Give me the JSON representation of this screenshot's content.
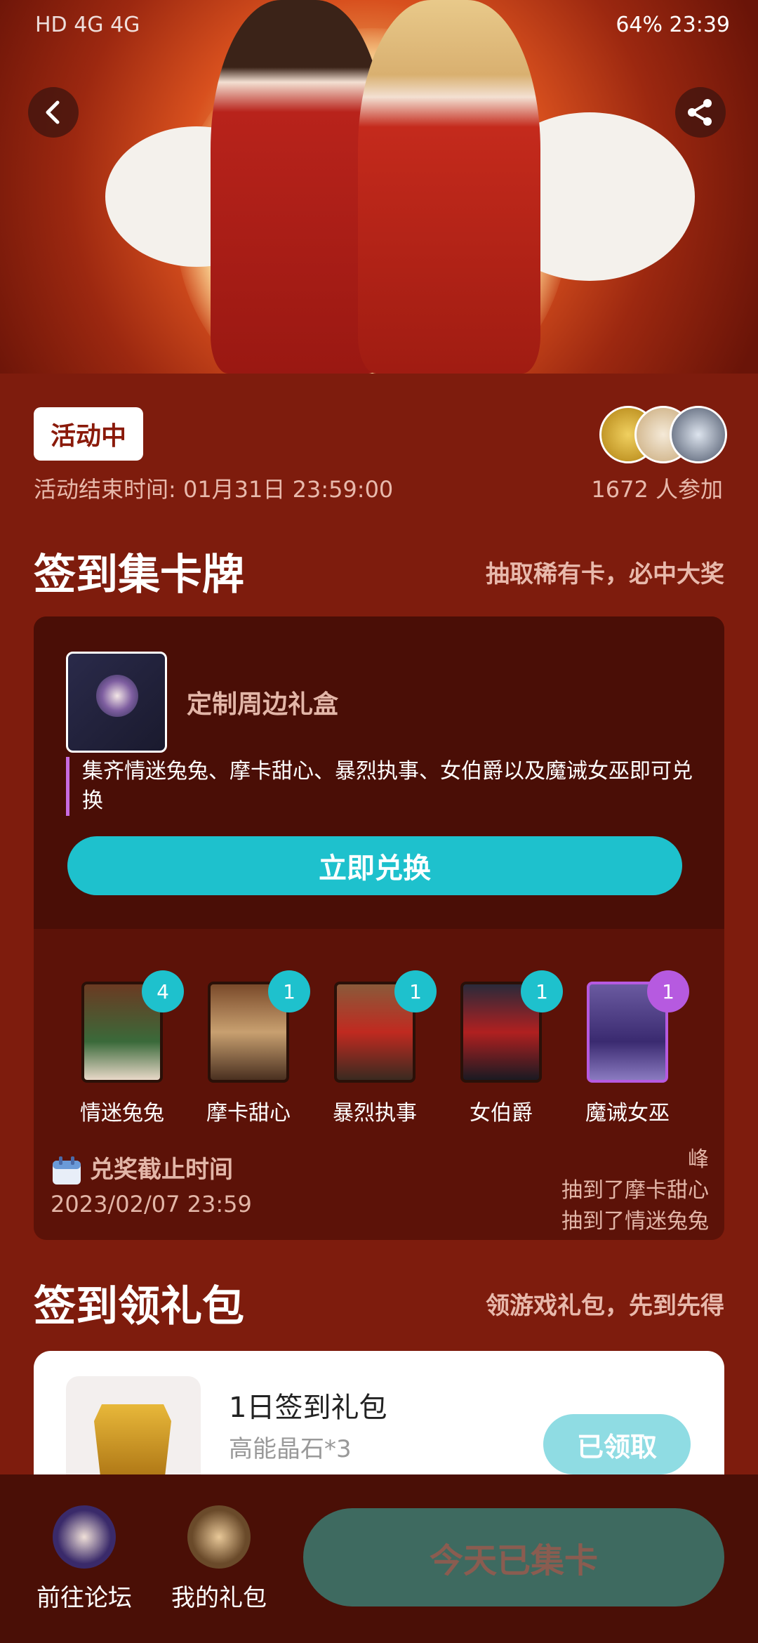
{
  "status_bar": {
    "left": "HD 4G 4G",
    "right": "64% 23:39"
  },
  "hero": {
    "back_label": "back",
    "share_label": "share"
  },
  "event": {
    "status_badge": "活动中",
    "end_time": "活动结束时间: 01月31日 23:59:00",
    "participants": "1672 人参加"
  },
  "card_section": {
    "title": "签到集卡牌",
    "subtitle": "抽取稀有卡，必中大奖",
    "reward_name": "定制周边礼盒",
    "reward_desc": "集齐情迷兔兔、摩卡甜心、暴烈执事、女伯爵以及魔诫女巫即可兑换",
    "redeem_button": "立即兑换",
    "cards": [
      {
        "name": "情迷兔兔",
        "count": "4",
        "color": "#1ec1cd"
      },
      {
        "name": "摩卡甜心",
        "count": "1",
        "color": "#1ec1cd"
      },
      {
        "name": "暴烈执事",
        "count": "1",
        "color": "#1ec1cd"
      },
      {
        "name": "女伯爵",
        "count": "1",
        "color": "#1ec1cd"
      },
      {
        "name": "魔诫女巫",
        "count": "1",
        "color": "#b65ae0"
      }
    ],
    "deadline_label": "兑奖截止时间",
    "deadline_value": "2023/02/07 23:59",
    "ticker": [
      "峰",
      "抽到了摩卡甜心",
      "抽到了情迷兔兔"
    ]
  },
  "gift_section": {
    "title": "签到领礼包",
    "subtitle": "领游戏礼包，先到先得",
    "pack_name": "1日签到礼包",
    "pack_desc": "高能晶石*3",
    "claimed_button": "已领取"
  },
  "bottom_bar": {
    "forum_label": "前往论坛",
    "gifts_label": "我的礼包",
    "main_button": "今天已集卡"
  },
  "colors": {
    "accent": "#1ec1cd",
    "background": "#7e1c0d",
    "panel": "#5c1208"
  }
}
